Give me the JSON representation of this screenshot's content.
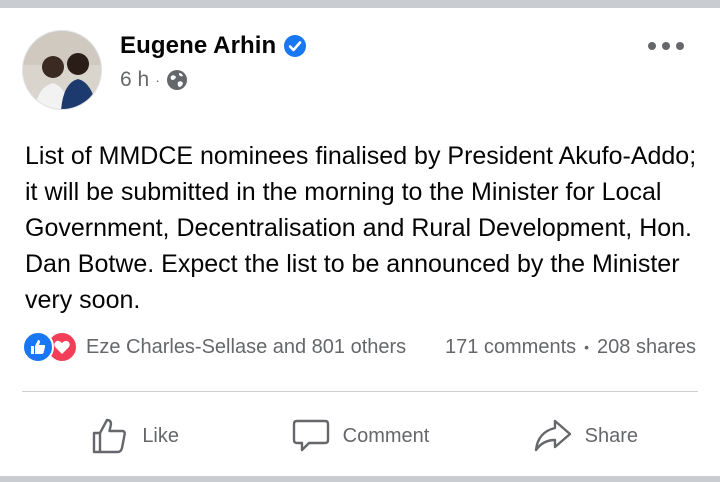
{
  "post": {
    "author": "Eugene Arhin",
    "time": "6 h",
    "separator": "·",
    "audience_icon": "globe-icon",
    "verified_icon": "verified-badge-icon",
    "body": "List of MMDCE nominees finalised by President Akufo-Addo; it will be submitted in the morning to the Minister for Local Government, Decentralisation and Rural Development, Hon. Dan Botwe. Expect the list to be announced by the Minister very soon."
  },
  "stats": {
    "reaction_icons": [
      "like-reaction-icon",
      "love-reaction-icon"
    ],
    "reacted_by": "Eze Charles-Sellase and 801 others",
    "comments": "171 comments",
    "separator": "•",
    "shares": "208 shares"
  },
  "actions": {
    "like": "Like",
    "comment": "Comment",
    "share": "Share"
  },
  "colors": {
    "accent": "#1877f2",
    "love": "#f33e58",
    "secondary_text": "#65676b",
    "divider": "#ced0d4"
  }
}
